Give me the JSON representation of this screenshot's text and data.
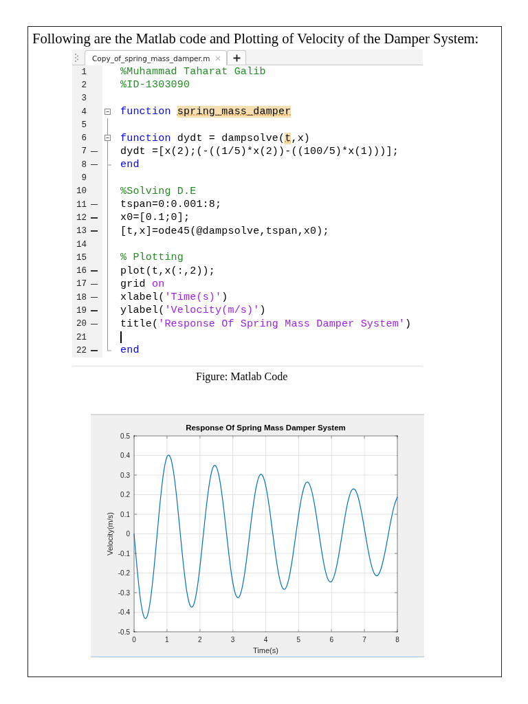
{
  "heading": "Following are the Matlab code and Plotting of Velocity of the Damper System:",
  "editor": {
    "tabs": [
      {
        "label": "Copy_of_spring_mass_damper.m",
        "selected": true
      }
    ],
    "lines": [
      {
        "number": "1",
        "executable": false,
        "collapsible": false,
        "fold_end": false,
        "cursor": false,
        "tokens": [
          {
            "text": "%Muhammad Taharat Galib",
            "kind": "comment"
          }
        ]
      },
      {
        "number": "2",
        "executable": false,
        "collapsible": false,
        "fold_end": false,
        "cursor": false,
        "tokens": [
          {
            "text": "%ID-1303090",
            "kind": "comment"
          }
        ]
      },
      {
        "number": "3",
        "executable": false,
        "collapsible": false,
        "fold_end": false,
        "cursor": false
      },
      {
        "number": "4",
        "executable": false,
        "collapsible": true,
        "fold_end": false,
        "cursor": false,
        "tokens": [
          {
            "text": "function ",
            "kind": "keyword"
          },
          {
            "text": "spring_mass_damper",
            "kind": "highlight"
          }
        ]
      },
      {
        "number": "5",
        "executable": false,
        "collapsible": false,
        "fold_end": false,
        "cursor": false
      },
      {
        "number": "6",
        "executable": false,
        "collapsible": true,
        "fold_end": false,
        "cursor": false,
        "tokens": [
          {
            "text": "function",
            "kind": "keyword"
          },
          {
            "text": " dydt = dampsolve(",
            "kind": "plain"
          },
          {
            "text": "t",
            "kind": "highlight"
          },
          {
            "text": ",x)",
            "kind": "plain"
          }
        ]
      },
      {
        "number": "7",
        "executable": true,
        "collapsible": false,
        "fold_end": false,
        "cursor": false,
        "tokens": [
          {
            "text": "dydt =[x(2);(-((1/5)*x(2))-((100/5)*x(1)))];",
            "kind": "plain"
          }
        ]
      },
      {
        "number": "8",
        "executable": true,
        "collapsible": false,
        "fold_end": true,
        "cursor": false,
        "tokens": [
          {
            "text": "end",
            "kind": "keyword"
          }
        ]
      },
      {
        "number": "9",
        "executable": false,
        "collapsible": false,
        "fold_end": false,
        "cursor": false
      },
      {
        "number": "10",
        "executable": false,
        "collapsible": false,
        "fold_end": false,
        "cursor": false,
        "tokens": [
          {
            "text": "%Solving D.E",
            "kind": "comment"
          }
        ]
      },
      {
        "number": "11",
        "executable": true,
        "collapsible": false,
        "fold_end": false,
        "cursor": false,
        "tokens": [
          {
            "text": "tspan=0:0.001:8;",
            "kind": "plain"
          }
        ]
      },
      {
        "number": "12",
        "executable": true,
        "collapsible": false,
        "fold_end": false,
        "cursor": false,
        "tokens": [
          {
            "text": "x0=[0.1;0];",
            "kind": "plain"
          }
        ]
      },
      {
        "number": "13",
        "executable": true,
        "collapsible": false,
        "fold_end": false,
        "cursor": false,
        "tokens": [
          {
            "text": "[t,x]=ode45(@dampsolve,tspan,x0);",
            "kind": "plain"
          }
        ]
      },
      {
        "number": "14",
        "executable": false,
        "collapsible": false,
        "fold_end": false,
        "cursor": false
      },
      {
        "number": "15",
        "executable": false,
        "collapsible": false,
        "fold_end": false,
        "cursor": false,
        "tokens": [
          {
            "text": "% Plotting",
            "kind": "comment"
          }
        ]
      },
      {
        "number": "16",
        "executable": true,
        "collapsible": false,
        "fold_end": false,
        "cursor": false,
        "tokens": [
          {
            "text": "plot(t,x(:,2));",
            "kind": "plain"
          }
        ]
      },
      {
        "number": "17",
        "executable": true,
        "collapsible": false,
        "fold_end": false,
        "cursor": false,
        "tokens": [
          {
            "text": "grid ",
            "kind": "plain"
          },
          {
            "text": "on",
            "kind": "string"
          }
        ]
      },
      {
        "number": "18",
        "executable": true,
        "collapsible": false,
        "fold_end": false,
        "cursor": false,
        "tokens": [
          {
            "text": "xlabel(",
            "kind": "plain"
          },
          {
            "text": "'Time(s)'",
            "kind": "string"
          },
          {
            "text": ")",
            "kind": "plain"
          }
        ]
      },
      {
        "number": "19",
        "executable": true,
        "collapsible": false,
        "fold_end": false,
        "cursor": false,
        "tokens": [
          {
            "text": "ylabel(",
            "kind": "plain"
          },
          {
            "text": "'Velocity(m/s)'",
            "kind": "string"
          },
          {
            "text": ")",
            "kind": "plain"
          }
        ]
      },
      {
        "number": "20",
        "executable": true,
        "collapsible": false,
        "fold_end": false,
        "cursor": false,
        "tokens": [
          {
            "text": "title(",
            "kind": "plain"
          },
          {
            "text": "'Response Of Spring Mass Damper System'",
            "kind": "string"
          },
          {
            "text": ")",
            "kind": "plain"
          }
        ]
      },
      {
        "number": "21",
        "executable": false,
        "collapsible": false,
        "fold_end": false,
        "cursor": true
      },
      {
        "number": "22",
        "executable": true,
        "collapsible": false,
        "fold_end": true,
        "cursor": false,
        "tokens": [
          {
            "text": "end",
            "kind": "keyword"
          }
        ]
      }
    ]
  },
  "code_caption": "Figure: Matlab Code",
  "figure": {
    "chart_data": {
      "type": "line",
      "title": "Response Of Spring Mass Damper System",
      "xlabel": "Time(s)",
      "ylabel": "Velocity(m/s)",
      "grid": true,
      "xlim": [
        0,
        8
      ],
      "ylim": [
        -0.5,
        0.5
      ],
      "xticks": [
        0,
        1,
        2,
        3,
        4,
        5,
        6,
        7,
        8
      ],
      "yticks": [
        -0.5,
        -0.4,
        -0.3,
        -0.2,
        -0.1,
        0,
        0.1,
        0.2,
        0.3,
        0.4,
        0.5
      ],
      "x": [
        0,
        0.1,
        0.2,
        0.3,
        0.4,
        0.5,
        0.6,
        0.7,
        0.8,
        0.9,
        1,
        1.1,
        1.2,
        1.3,
        1.4,
        1.5,
        1.6,
        1.7,
        1.8,
        1.9,
        2,
        2.1,
        2.2,
        2.3,
        2.4,
        2.5,
        2.6,
        2.7,
        2.8,
        2.9,
        3,
        3.1,
        3.2,
        3.3,
        3.4,
        3.5,
        3.6,
        3.7,
        3.8,
        3.9,
        4,
        4.1,
        4.2,
        4.3,
        4.4,
        4.5,
        4.6,
        4.7,
        4.8,
        4.9,
        5,
        5.1,
        5.2,
        5.3,
        5.4,
        5.5,
        5.6,
        5.7,
        5.8,
        5.9,
        6,
        6.1,
        6.2,
        6.3,
        6.4,
        6.5,
        6.6,
        6.7,
        6.8,
        6.9,
        7,
        7.1,
        7.2,
        7.3,
        7.4,
        7.5,
        7.6,
        7.7,
        7.8,
        7.9,
        8
      ],
      "series": [
        {
          "color": "#0072bd",
          "values": [
            0,
            -0.191,
            -0.342,
            -0.423,
            -0.42,
            -0.335,
            -0.186,
            -0.005,
            0.174,
            0.316,
            0.393,
            0.392,
            0.315,
            0.178,
            0.009,
            -0.158,
            -0.292,
            -0.365,
            -0.366,
            -0.296,
            -0.17,
            -0.012,
            0.144,
            0.269,
            0.34,
            0.342,
            0.278,
            0.162,
            0.016,
            -0.131,
            -0.249,
            -0.316,
            -0.32,
            -0.262,
            -0.154,
            -0.018,
            0.119,
            0.229,
            0.294,
            0.299,
            0.246,
            0.147,
            0.02,
            -0.107,
            -0.212,
            -0.273,
            -0.279,
            -0.231,
            -0.139,
            -0.022,
            0.097,
            0.195,
            0.254,
            0.261,
            0.217,
            0.132,
            0.023,
            -0.088,
            -0.18,
            -0.235,
            -0.243,
            -0.204,
            -0.126,
            -0.025,
            0.079,
            0.166,
            0.219,
            0.227,
            0.192,
            0.119,
            0.025,
            -0.072,
            -0.153,
            -0.203,
            -0.212,
            -0.18,
            -0.113,
            -0.026,
            0.065,
            0.141,
            0.189
          ]
        }
      ]
    }
  }
}
